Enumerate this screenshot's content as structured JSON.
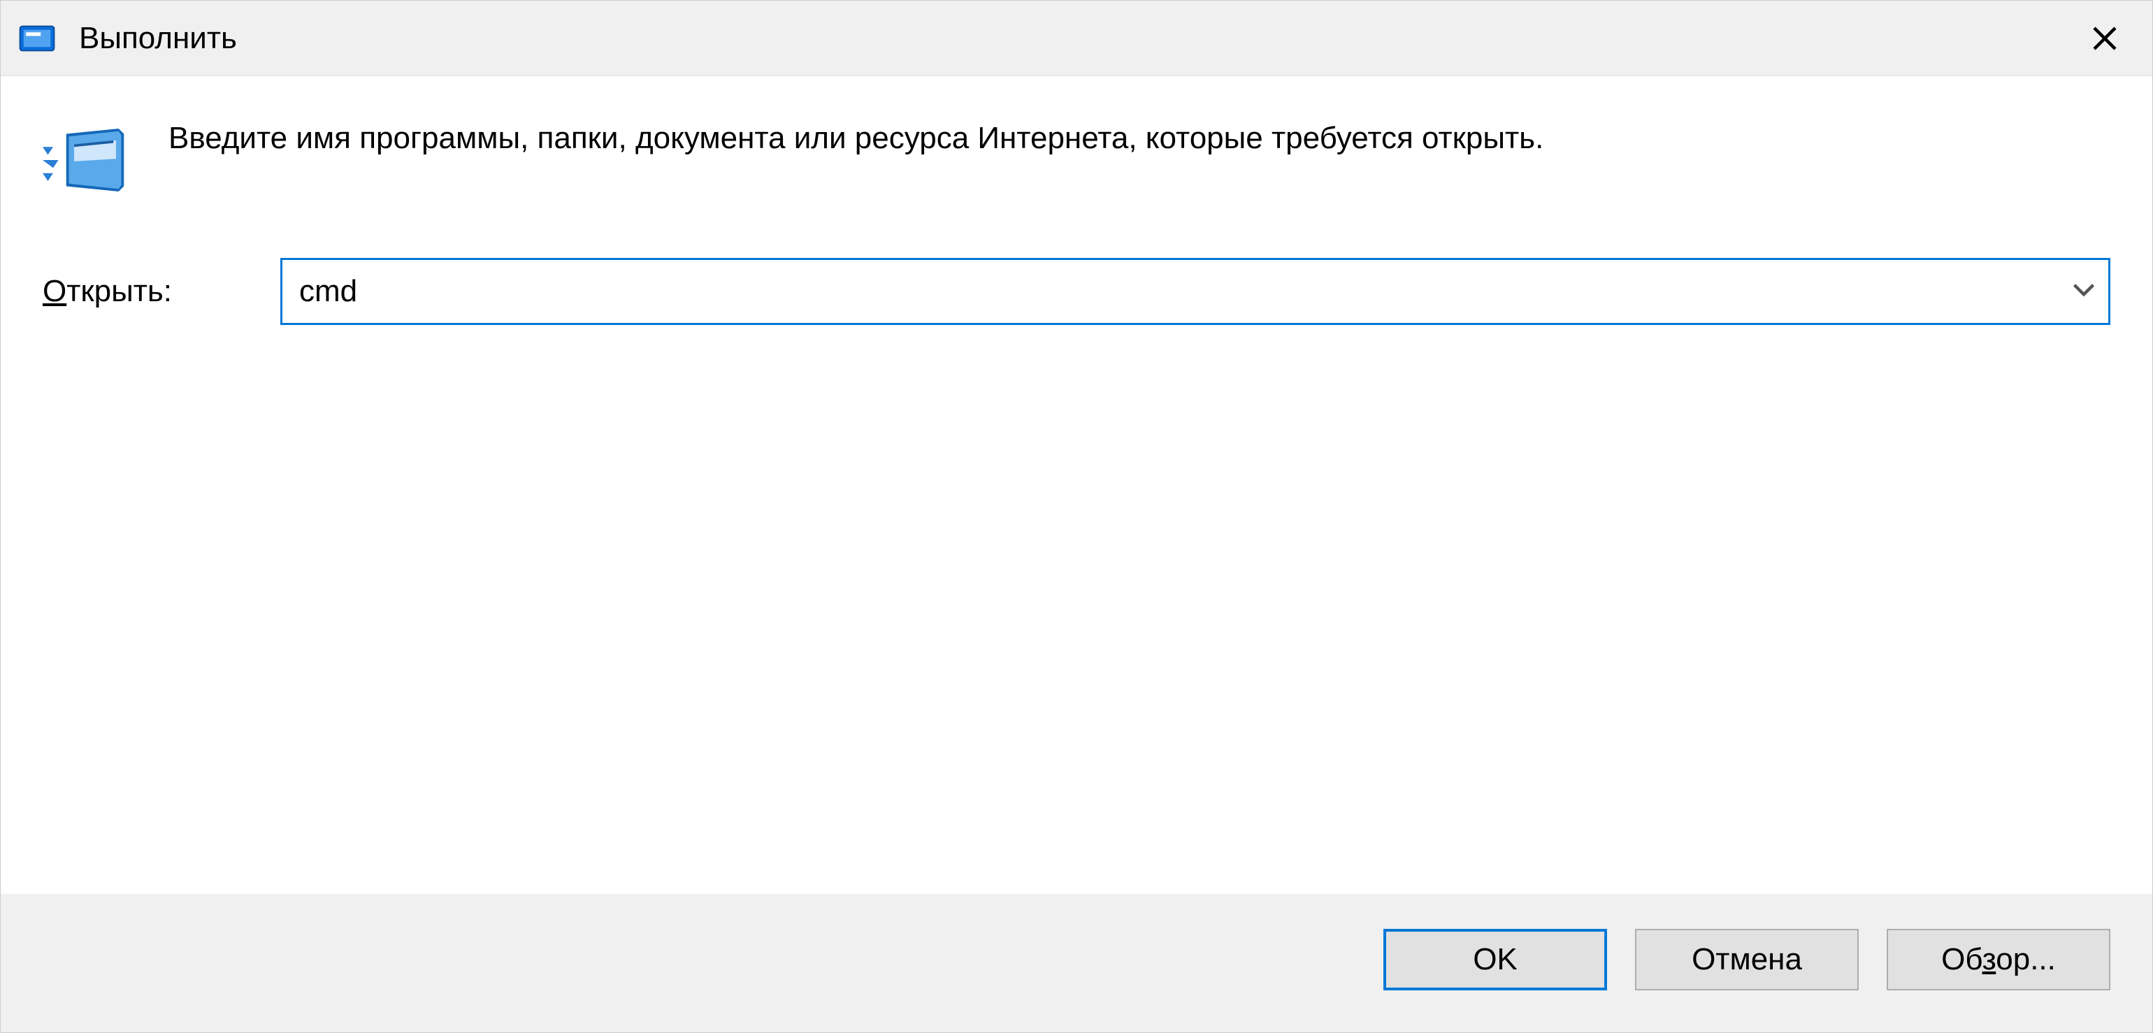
{
  "titlebar": {
    "title": "Выполнить"
  },
  "content": {
    "description": "Введите имя программы, папки, документа или ресурса Интернета, которые требуется открыть.",
    "open_label_prefix": "О",
    "open_label_rest": "ткрыть:",
    "input_value": "cmd"
  },
  "buttons": {
    "ok": "OK",
    "cancel": "Отмена",
    "browse_prefix": "Об",
    "browse_underline": "з",
    "browse_rest": "ор..."
  }
}
